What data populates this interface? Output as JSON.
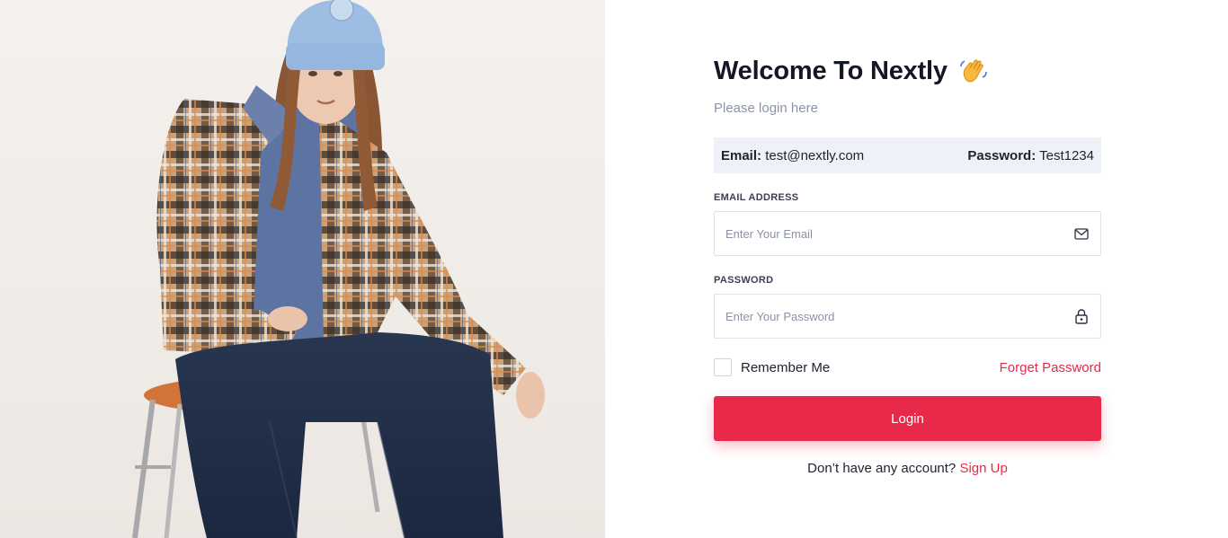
{
  "hero": {
    "image_alt": "woman in plaid shirt and blue beanie sitting on a stool"
  },
  "login": {
    "title": "Welcome To Nextly",
    "title_emoji": "waving-hand-icon",
    "subtitle": "Please login here",
    "demo_credentials": {
      "email_label": "Email:",
      "email_value": "test@nextly.com",
      "password_label": "Password:",
      "password_value": "Test1234"
    },
    "email": {
      "label": "EMAIL ADDRESS",
      "placeholder": "Enter Your Email",
      "value": "",
      "icon": "mail-icon"
    },
    "password": {
      "label": "PASSWORD",
      "placeholder": "Enter Your Password",
      "value": "",
      "icon": "lock-icon"
    },
    "remember_label": "Remember Me",
    "remember_checked": false,
    "forgot_label": "Forget Password",
    "submit_label": "Login",
    "signup_prompt": "Don’t have any account?",
    "signup_label": "Sign Up"
  },
  "colors": {
    "accent": "#e8294a",
    "title": "#141826",
    "muted": "#8a93a8",
    "credentials_bg": "#eef2f8",
    "border": "#dfe2e8"
  }
}
